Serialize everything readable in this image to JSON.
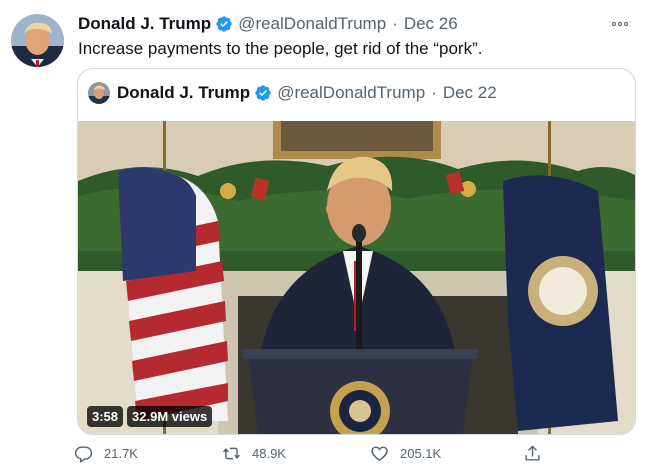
{
  "tweet": {
    "author_name": "Donald J. Trump",
    "author_handle": "@realDonaldTrump",
    "separator": "·",
    "date": "Dec 26",
    "text": "Increase payments to the people, get rid of the “pork”.",
    "avatar_icon": "profile-photo",
    "verified_icon": "verified-badge-icon",
    "more_icon": "more-options-icon"
  },
  "quoted_tweet": {
    "author_name": "Donald J. Trump",
    "author_handle": "@realDonaldTrump",
    "separator": "·",
    "date": "Dec 22",
    "video": {
      "duration": "3:58",
      "views": "32.9M views"
    }
  },
  "actions": {
    "reply_count": "21.7K",
    "retweet_count": "48.9K",
    "like_count": "205.1K",
    "icons": [
      "reply-icon",
      "retweet-icon",
      "like-icon",
      "share-icon"
    ]
  },
  "colors": {
    "verified_blue": "#1d9bf0",
    "secondary_text": "#536471",
    "border": "#cfd9de"
  }
}
